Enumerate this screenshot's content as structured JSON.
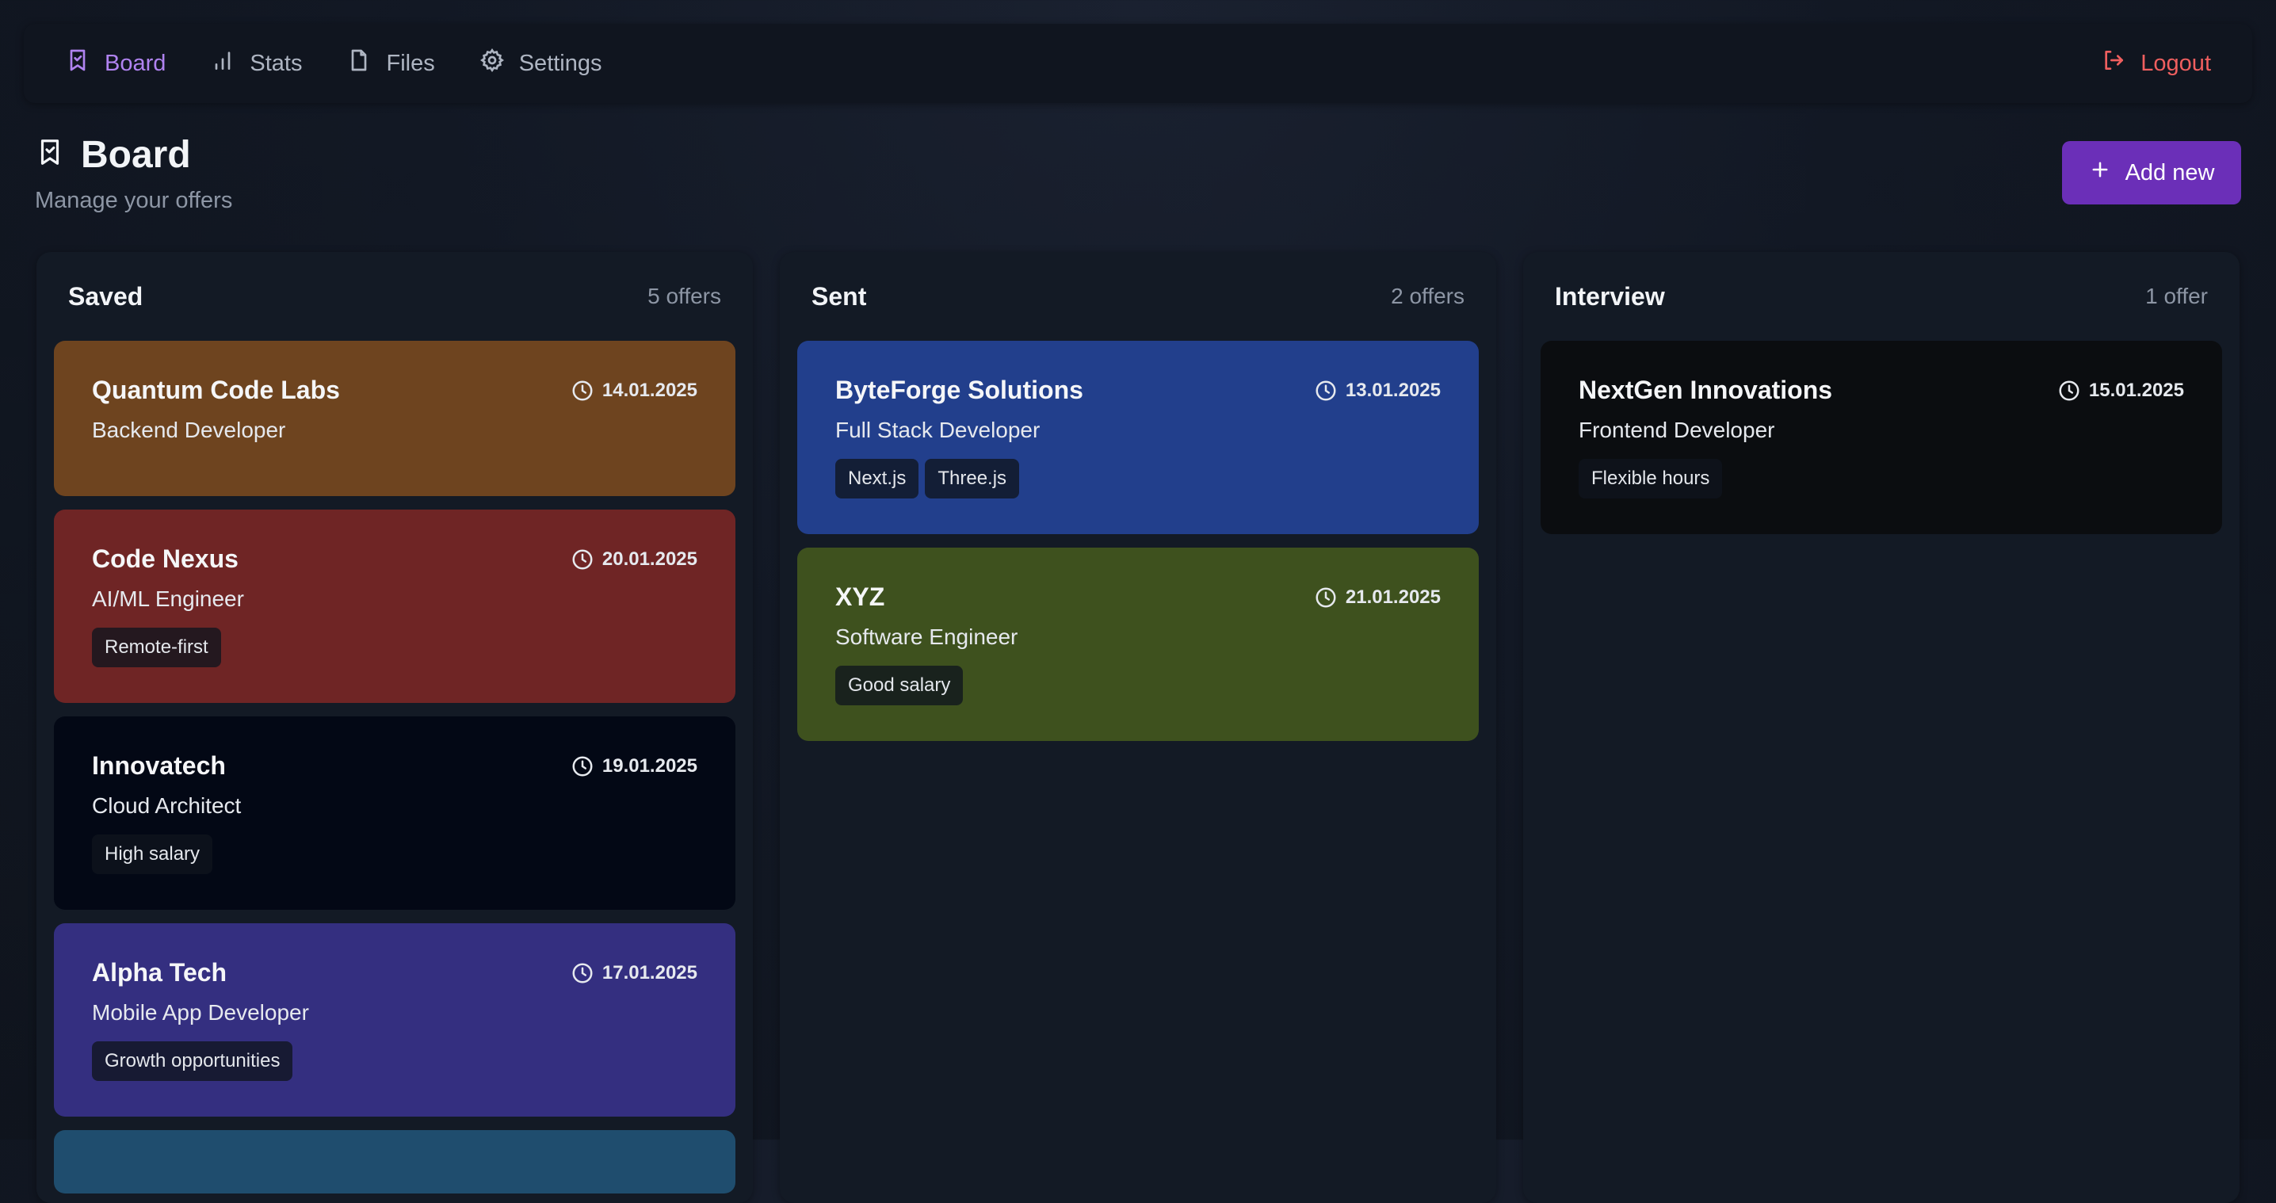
{
  "nav": {
    "items": [
      {
        "label": "Board",
        "icon": "bookmark-icon",
        "active": true
      },
      {
        "label": "Stats",
        "icon": "bar-chart-icon",
        "active": false
      },
      {
        "label": "Files",
        "icon": "file-icon",
        "active": false
      },
      {
        "label": "Settings",
        "icon": "gear-icon",
        "active": false
      }
    ],
    "logout": "Logout"
  },
  "header": {
    "title": "Board",
    "subtitle": "Manage your offers",
    "add_button": "Add new"
  },
  "colors": {
    "accent": "#6b2fb8",
    "active_nav": "#b083f0",
    "logout": "#ef5f5f"
  },
  "columns": [
    {
      "title": "Saved",
      "count": "5 offers",
      "cards": [
        {
          "company": "Quantum Code Labs",
          "role": "Backend Developer",
          "date": "14.01.2025",
          "tags": [],
          "color": "#6e441f"
        },
        {
          "company": "Code Nexus",
          "role": "AI/ML Engineer",
          "date": "20.01.2025",
          "tags": [
            "Remote-first"
          ],
          "color": "#6f2525"
        },
        {
          "company": "Innovatech",
          "role": "Cloud Architect",
          "date": "19.01.2025",
          "tags": [
            "High salary"
          ],
          "color": "#030815"
        },
        {
          "company": "Alpha Tech",
          "role": "Mobile App Developer",
          "date": "17.01.2025",
          "tags": [
            "Growth opportunities"
          ],
          "color": "#342f80"
        },
        {
          "company": "",
          "role": "",
          "date": "",
          "tags": [],
          "color": "#1f4d6e"
        }
      ]
    },
    {
      "title": "Sent",
      "count": "2 offers",
      "cards": [
        {
          "company": "ByteForge Solutions",
          "role": "Full Stack Developer",
          "date": "13.01.2025",
          "tags": [
            "Next.js",
            "Three.js"
          ],
          "color": "#223f8c"
        },
        {
          "company": "XYZ",
          "role": "Software Engineer",
          "date": "21.01.2025",
          "tags": [
            "Good salary"
          ],
          "color": "#3e511e"
        }
      ]
    },
    {
      "title": "Interview",
      "count": "1 offer",
      "cards": [
        {
          "company": "NextGen Innovations",
          "role": "Frontend Developer",
          "date": "15.01.2025",
          "tags": [
            "Flexible hours"
          ],
          "color": "#0b0d10"
        }
      ]
    }
  ]
}
